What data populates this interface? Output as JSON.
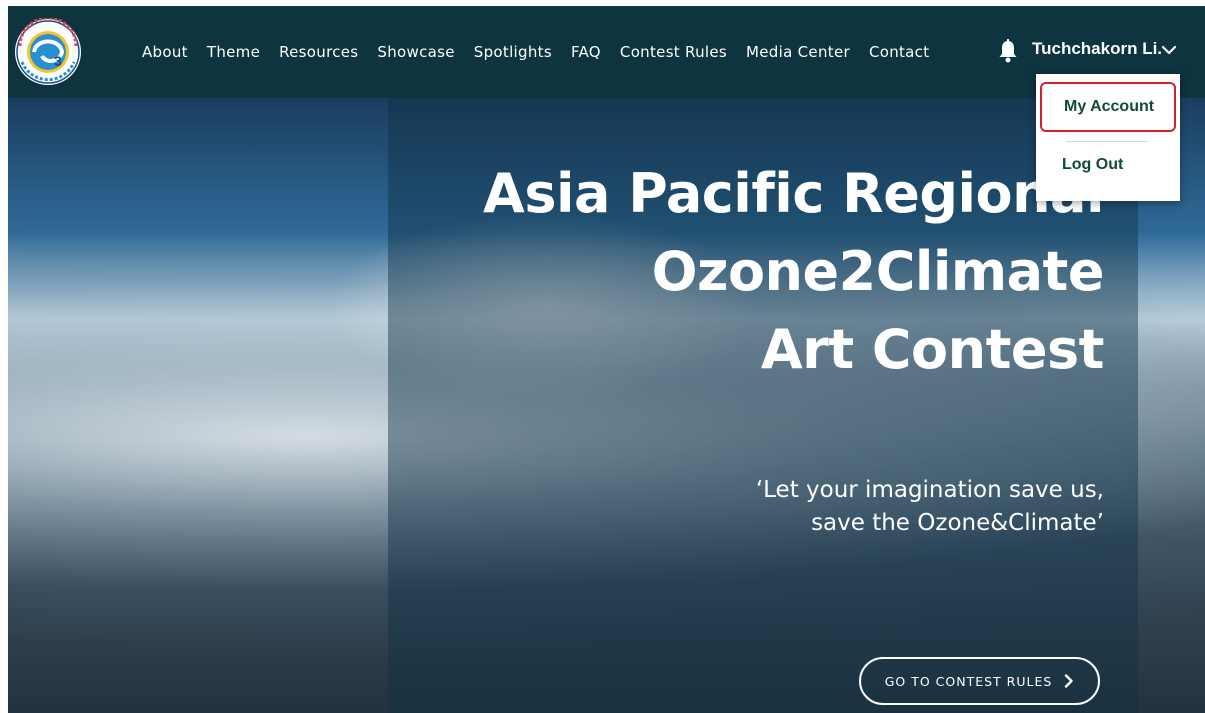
{
  "nav": {
    "links": [
      "About",
      "Theme",
      "Resources",
      "Showcase",
      "Spotlights",
      "FAQ",
      "Contest Rules",
      "Media Center",
      "Contact"
    ],
    "logo_icon": "asia-pacific-ozone2climate-logo",
    "bell_icon": "bell-icon",
    "user_name": "Tuchchakorn Li.",
    "chevron_icon": "chevron-down-icon"
  },
  "dropdown": {
    "my_account": "My Account",
    "log_out": "Log Out",
    "highlight_color": "#d6202a"
  },
  "hero": {
    "title_lines": [
      "Asia Pacific Regional",
      "Ozone2Climate",
      "Art Contest"
    ],
    "subtitle_lines": [
      "‘Let your imagination save us,",
      "save the Ozone&Climate’"
    ],
    "cta_label": "GO TO CONTEST RULES"
  },
  "colors": {
    "navbar": "#0e3440",
    "dropdown_text": "#0f4a3c"
  }
}
